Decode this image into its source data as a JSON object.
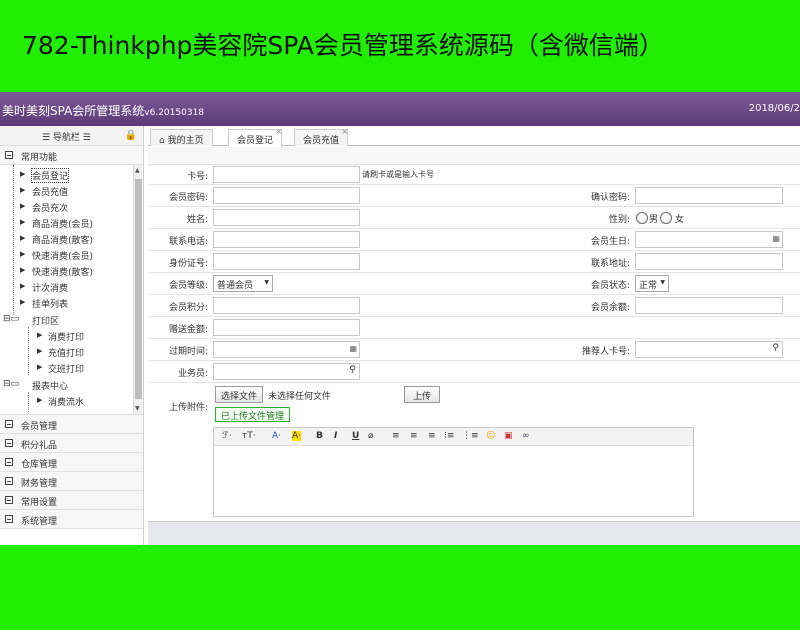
{
  "banner": {
    "title": "782-Thinkphp美容院SPA会员管理系统源码（含微信端）"
  },
  "app": {
    "title": "美时美刻SPA会所管理系统",
    "version": "v6.20150318",
    "date": "2018/06/2"
  },
  "sidebar": {
    "header": "☰ 导航栏 ☰",
    "top_section": "常用功能",
    "tree": [
      "会员登记",
      "会员充值",
      "会员充次",
      "商品消费(会员)",
      "商品消费(散客)",
      "快速消费(会员)",
      "快速消费(散客)",
      "计次消费",
      "挂单列表"
    ],
    "print_group": "打印区",
    "print_items": [
      "消费打印",
      "充值打印",
      "交班打印"
    ],
    "report_group": "报表中心",
    "report_items": [
      "消费流水"
    ],
    "sections": [
      "会员管理",
      "积分礼品",
      "仓库管理",
      "财务管理",
      "常用设置",
      "系统管理"
    ]
  },
  "tabs": [
    {
      "label": "我的主页",
      "icon": "home-icon"
    },
    {
      "label": "会员登记"
    },
    {
      "label": "会员充值"
    }
  ],
  "form": {
    "card_no": "卡号:",
    "card_hint": "请刷卡或是输入卡号",
    "password": "会员密码:",
    "confirm_password": "确认密码:",
    "name": "姓名:",
    "gender": "性别:",
    "male": "男",
    "female": "女",
    "phone": "联系电话:",
    "birthday": "会员生日:",
    "id_card": "身份证号:",
    "address": "联系地址:",
    "level": "会员等级:",
    "level_value": "普通会员",
    "status": "会员状态:",
    "status_value": "正常",
    "points": "会员积分:",
    "balance": "会员余额:",
    "gift_amount": "赠送金额:",
    "expire": "过期时间:",
    "referrer": "推荐人卡号:",
    "staff": "业务员:",
    "attachment": "上传附件:",
    "choose_file": "选择文件",
    "no_file": "未选择任何文件",
    "upload": "上传",
    "uploaded_files": "已上传文件管理"
  },
  "editor": {
    "tools": [
      "ℱ·",
      "тT·",
      "A·",
      "A·",
      "B",
      "I",
      "U",
      "⌀",
      "≡",
      "≡",
      "≡",
      "⁝≡",
      "⋮≡",
      "☺",
      "▣",
      "∞"
    ]
  }
}
